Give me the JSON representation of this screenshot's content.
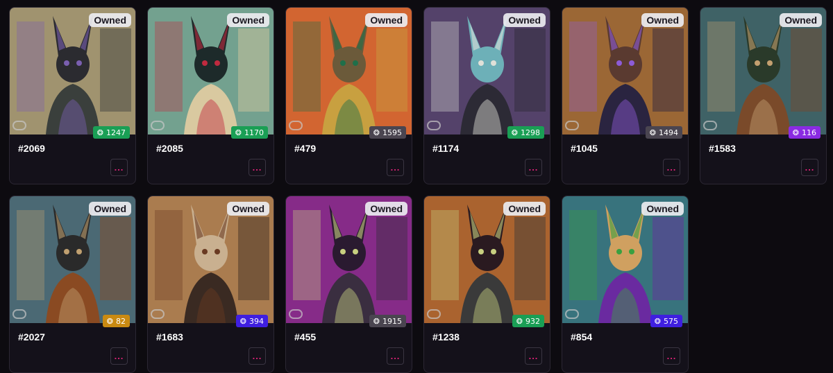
{
  "owned_label": "Owned",
  "more_label": "...",
  "colors": {
    "rank_green": "#1a9f55",
    "rank_grey": "#4a4550",
    "rank_purple": "#8a2be2",
    "rank_gold": "#c98a12",
    "rank_blue": "#3f1fe0",
    "more_accent": "#e2227a"
  },
  "cards": [
    {
      "title": "#2069",
      "rank": "1247",
      "rank_color": "#1a9f55"
    },
    {
      "title": "#2085",
      "rank": "1170",
      "rank_color": "#1a9f55"
    },
    {
      "title": "#479",
      "rank": "1595",
      "rank_color": "#4a4550"
    },
    {
      "title": "#1174",
      "rank": "1298",
      "rank_color": "#1a9f55"
    },
    {
      "title": "#1045",
      "rank": "1494",
      "rank_color": "#4a4550"
    },
    {
      "title": "#1583",
      "rank": "116",
      "rank_color": "#8a2be2"
    },
    {
      "title": "#2027",
      "rank": "82",
      "rank_color": "#c98a12"
    },
    {
      "title": "#1683",
      "rank": "394",
      "rank_color": "#3f1fe0"
    },
    {
      "title": "#455",
      "rank": "1915",
      "rank_color": "#4a4550"
    },
    {
      "title": "#1238",
      "rank": "932",
      "rank_color": "#1a9f55"
    },
    {
      "title": "#854",
      "rank": "575",
      "rank_color": "#3f1fe0"
    }
  ]
}
